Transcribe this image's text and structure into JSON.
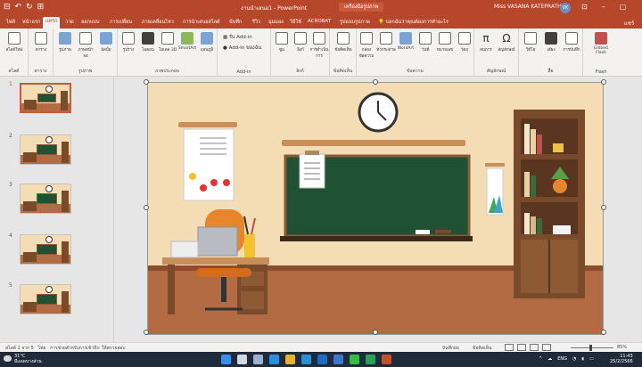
{
  "app": {
    "title": "งานนำเสนอ1 - PowerPoint",
    "badge": "เครื่องมือรูปภาพ",
    "user": "Miss VASANA KATEPRATHUM",
    "user_initials": "VK",
    "quick_access": [
      "⊟",
      "↶",
      "↻",
      "⊞"
    ]
  },
  "tabs": {
    "items": [
      {
        "label": "ไฟล์",
        "active": false
      },
      {
        "label": "หน้าแรก",
        "active": false
      },
      {
        "label": "แทรก",
        "active": true
      },
      {
        "label": "วาด",
        "active": false
      },
      {
        "label": "ออกแบบ",
        "active": false
      },
      {
        "label": "การเปลี่ยน",
        "active": false
      },
      {
        "label": "ภาพเคลื่อนไหว",
        "active": false
      },
      {
        "label": "การนำเสนอสไลด์",
        "active": false
      },
      {
        "label": "บันทึก",
        "active": false
      },
      {
        "label": "รีวิว",
        "active": false
      },
      {
        "label": "มุมมอง",
        "active": false
      },
      {
        "label": "วิธีใช้",
        "active": false
      },
      {
        "label": "ACROBAT",
        "active": false
      },
      {
        "label": "รูปแบบรูปภาพ",
        "active": false
      }
    ],
    "search": "บอกฉันว่าคุณต้องการทำอะไร",
    "share": "แชร์"
  },
  "ribbon": {
    "groups": [
      {
        "label": "สไลด์",
        "buttons": [
          {
            "label": "สไลด์ใหม่",
            "icon": "slide-icon"
          }
        ]
      },
      {
        "label": "ตาราง",
        "buttons": [
          {
            "label": "ตาราง",
            "icon": "table-icon"
          }
        ]
      },
      {
        "label": "รูปภาพ",
        "buttons": [
          {
            "label": "รูปภาพ",
            "icon": "image-icon"
          },
          {
            "label": "ภาพหน้าจอ",
            "icon": "screenshot-icon"
          },
          {
            "label": "อัลบั้ม",
            "icon": "album-icon"
          }
        ]
      },
      {
        "label": "ภาพประกอบ",
        "buttons": [
          {
            "label": "รูปร่าง",
            "icon": "shape-icon"
          },
          {
            "label": "ไอคอน",
            "icon": "icons-icon"
          },
          {
            "label": "โมเดล 3D",
            "icon": "model-3d-icon"
          },
          {
            "label": "SmartArt",
            "icon": "smartart-icon"
          },
          {
            "label": "แผนภูมิ",
            "icon": "chart-icon"
          }
        ]
      },
      {
        "label": "Add-in",
        "addins": [
          "รับ Add-in",
          "Add-in ของฉัน"
        ]
      },
      {
        "label": "ลิงก์",
        "buttons": [
          {
            "label": "ซูม",
            "icon": "zoom-icon"
          },
          {
            "label": "ลิงก์",
            "icon": "link-icon"
          },
          {
            "label": "การดำเนินการ",
            "icon": "action-icon"
          }
        ]
      },
      {
        "label": "ข้อคิดเห็น",
        "buttons": [
          {
            "label": "ข้อคิดเห็น",
            "icon": "comment-icon"
          }
        ]
      },
      {
        "label": "ข้อความ",
        "buttons": [
          {
            "label": "กล่องข้อความ",
            "icon": "textbox-icon"
          },
          {
            "label": "หัวกระดาษ",
            "icon": "header-icon"
          },
          {
            "label": "WordArt",
            "icon": "wordart-icon"
          },
          {
            "label": "วันที่",
            "icon": "date-icon"
          },
          {
            "label": "หมายเลข",
            "icon": "number-icon"
          },
          {
            "label": "วัตถุ",
            "icon": "object-icon"
          }
        ]
      },
      {
        "label": "สัญลักษณ์",
        "buttons": [
          {
            "label": "สมการ",
            "icon": "equation-icon"
          },
          {
            "label": "สัญลักษณ์",
            "icon": "symbol-icon"
          }
        ]
      },
      {
        "label": "สื่อ",
        "buttons": [
          {
            "label": "วิดีโอ",
            "icon": "video-icon"
          },
          {
            "label": "เสียง",
            "icon": "audio-icon"
          },
          {
            "label": "การบันทึก",
            "icon": "screen-record-icon"
          }
        ]
      },
      {
        "label": "Flash",
        "buttons": [
          {
            "label": "Embed Flash",
            "icon": "flash-icon"
          }
        ]
      }
    ]
  },
  "thumbnails": {
    "slides": [
      {
        "number": "1",
        "selected": true
      },
      {
        "number": "2",
        "selected": false
      },
      {
        "number": "3",
        "selected": false
      },
      {
        "number": "4",
        "selected": false
      },
      {
        "number": "5",
        "selected": false
      }
    ]
  },
  "slide_scene": {
    "colors": {
      "wall": "#f4dcb4",
      "floor": "#b26b43",
      "board": "#1f5132",
      "wood": "#7a4b2a",
      "chair": "#e7852b"
    }
  },
  "status": {
    "slide_info": "สไลด์ 1 จาก 5",
    "language": "ไทย",
    "accessibility": "การช่วยสำหรับการเข้าถึง: ให้ตรวจสอบ",
    "notes": "บันทึกย่อ",
    "comments": "ข้อคิดเห็น",
    "zoom": "85%",
    "zoom_level": 0.45
  },
  "taskbar": {
    "weather_temp": "31°C",
    "weather_desc": "มีแดดบางส่วน",
    "tray_lang": "ENG",
    "time": "11:43",
    "date": "25/2/2566",
    "apps": [
      {
        "icon": "windows-icon",
        "color": "#3a8ee6"
      },
      {
        "icon": "search-icon",
        "color": "#cfd8e3"
      },
      {
        "icon": "task-view-icon",
        "color": "#9bb3cf"
      },
      {
        "icon": "edge-icon",
        "color": "#2d8fd5"
      },
      {
        "icon": "chrome-icon",
        "color": "#e2b23a"
      },
      {
        "icon": "store-icon",
        "color": "#2e8fd0"
      },
      {
        "icon": "outlook-icon",
        "color": "#1f6bc1"
      },
      {
        "icon": "mail-icon",
        "color": "#3d78c8"
      },
      {
        "icon": "line-icon",
        "color": "#3cb94b"
      },
      {
        "icon": "meet-icon",
        "color": "#2f9e5a"
      },
      {
        "icon": "photos-icon",
        "color": "#c1512d"
      }
    ]
  }
}
